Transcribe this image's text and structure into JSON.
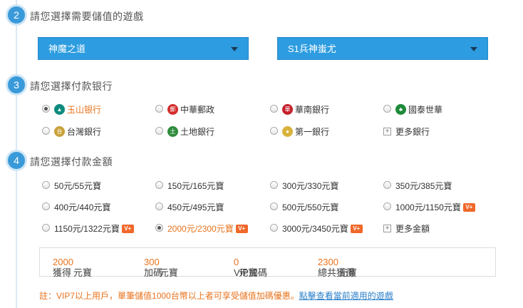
{
  "steps": [
    {
      "number": "2",
      "title": "請您選擇需要儲值的遊戲"
    },
    {
      "number": "3",
      "title": "請您選擇付款银行"
    },
    {
      "number": "4",
      "title": "請您選擇付款金額"
    }
  ],
  "game_select": {
    "value": "神魔之道"
  },
  "server_select": {
    "value": "S1兵神蚩尤"
  },
  "banks": [
    {
      "label": "玉山银行",
      "logo": "yushan-logo",
      "selected": true
    },
    {
      "label": "中華郵政",
      "logo": "post-logo",
      "selected": false
    },
    {
      "label": "華南銀行",
      "logo": "huanan-logo",
      "selected": false
    },
    {
      "label": "國泰世華",
      "logo": "cathay-logo",
      "selected": false
    },
    {
      "label": "台灣銀行",
      "logo": "taiwan-bank-logo",
      "selected": false
    },
    {
      "label": "土地銀行",
      "logo": "land-bank-logo",
      "selected": false
    },
    {
      "label": "第一銀行",
      "logo": "first-bank-logo",
      "selected": false
    }
  ],
  "more_banks": "更多銀行",
  "amounts": [
    {
      "label": "50元/55元寶",
      "vip": false,
      "selected": false
    },
    {
      "label": "150元/165元寶",
      "vip": false,
      "selected": false
    },
    {
      "label": "300元/330元寶",
      "vip": false,
      "selected": false
    },
    {
      "label": "350元/385元寶",
      "vip": false,
      "selected": false
    },
    {
      "label": "400元/440元寶",
      "vip": false,
      "selected": false
    },
    {
      "label": "450元/495元寶",
      "vip": false,
      "selected": false
    },
    {
      "label": "500元/550元寶",
      "vip": false,
      "selected": false
    },
    {
      "label": "1000元/1150元寶",
      "vip": true,
      "selected": false
    },
    {
      "label": "1150元/1322元寶",
      "vip": true,
      "selected": false
    },
    {
      "label": "2000元/2300元寶",
      "vip": true,
      "selected": true
    },
    {
      "label": "3000元/3450元寶",
      "vip": true,
      "selected": false
    }
  ],
  "vip_badge": "V+",
  "more_amounts": "更多金額",
  "summary": {
    "get_prefix": "獲得",
    "get_value": "2000",
    "get_suffix": "元寶",
    "bonus_prefix": "加碼",
    "bonus_value": "300",
    "bonus_suffix": "元寶",
    "vip_prefix": "VIP加碼",
    "vip_value": "0",
    "vip_suffix": "元寶",
    "total_prefix": "總共獲得",
    "total_value": "2300",
    "total_suffix": "元寶"
  },
  "note": {
    "text": "註：VIP7以上用戶，單筆儲值1000台幣以上者可享受儲值加碼優惠。",
    "link": "點擊查看當前適用的遊戲"
  },
  "colors": {
    "accent": "#2d9ce0",
    "highlight": "#e8731c",
    "badge": "#f0682a",
    "link": "#2b7fc9"
  }
}
